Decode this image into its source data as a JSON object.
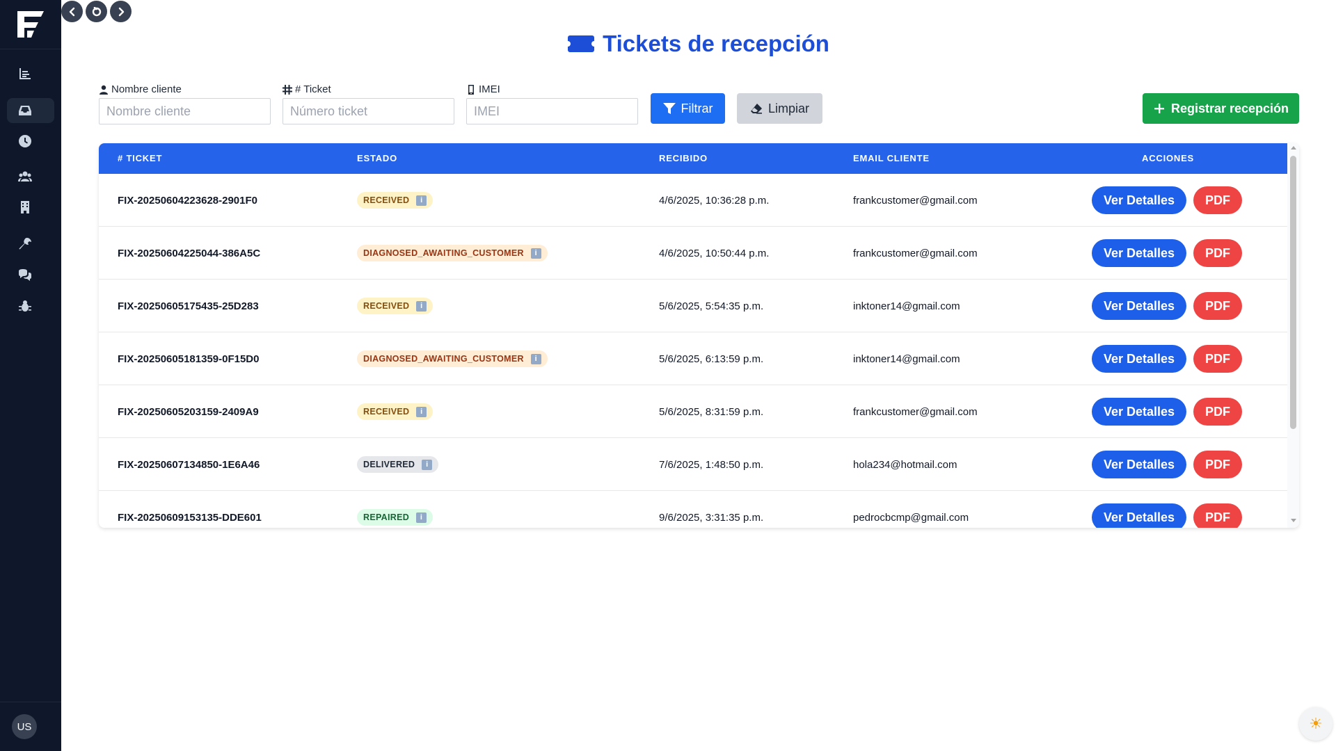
{
  "nav": {
    "back_icon": "chevron-left-icon",
    "reload_icon": "reload-icon",
    "forward_icon": "chevron-right-icon"
  },
  "sidebar": {
    "items": [
      {
        "icon": "chart-icon",
        "active": false
      },
      {
        "icon": "inbox-icon",
        "active": true
      },
      {
        "icon": "clock-icon",
        "active": false
      },
      {
        "icon": "users-icon",
        "active": false
      },
      {
        "icon": "building-icon",
        "active": false
      },
      {
        "icon": "wrench-icon",
        "active": false
      },
      {
        "icon": "chat-icon",
        "active": false
      },
      {
        "icon": "bug-icon",
        "active": false
      }
    ],
    "avatar": "US"
  },
  "page": {
    "title": "Tickets de recepción",
    "title_icon": "ticket-icon",
    "title_color": "#1d4ed8"
  },
  "filters": {
    "name_label": "Nombre cliente",
    "name_placeholder": "Nombre cliente",
    "ticket_label": "# Ticket",
    "ticket_placeholder": "Número ticket",
    "imei_label": "IMEI",
    "imei_placeholder": "IMEI",
    "filter_button": "Filtrar",
    "clear_button": "Limpiar",
    "register_button": "Registrar recepción"
  },
  "table": {
    "headers": [
      "# TICKET",
      "ESTADO",
      "RECIBIDO",
      "EMAIL CLIENTE",
      "ACCIONES"
    ],
    "details_label": "Ver Detalles",
    "pdf_label": "PDF",
    "rows": [
      {
        "ticket": "FIX-20250604223628-2901F0",
        "status": "RECEIVED",
        "status_class": "b-received",
        "received": "4/6/2025, 10:36:28 p.m.",
        "email": "frankcustomer@gmail.com"
      },
      {
        "ticket": "FIX-20250604225044-386A5C",
        "status": "DIAGNOSED_AWAITING_CUSTOMER",
        "status_class": "b-diag",
        "received": "4/6/2025, 10:50:44 p.m.",
        "email": "frankcustomer@gmail.com"
      },
      {
        "ticket": "FIX-20250605175435-25D283",
        "status": "RECEIVED",
        "status_class": "b-received",
        "received": "5/6/2025, 5:54:35 p.m.",
        "email": "inktoner14@gmail.com"
      },
      {
        "ticket": "FIX-20250605181359-0F15D0",
        "status": "DIAGNOSED_AWAITING_CUSTOMER",
        "status_class": "b-diag",
        "received": "5/6/2025, 6:13:59 p.m.",
        "email": "inktoner14@gmail.com"
      },
      {
        "ticket": "FIX-20250605203159-2409A9",
        "status": "RECEIVED",
        "status_class": "b-received",
        "received": "5/6/2025, 8:31:59 p.m.",
        "email": "frankcustomer@gmail.com"
      },
      {
        "ticket": "FIX-20250607134850-1E6A46",
        "status": "DELIVERED",
        "status_class": "b-deliv",
        "received": "7/6/2025, 1:48:50 p.m.",
        "email": "hola234@hotmail.com"
      },
      {
        "ticket": "FIX-20250609153135-DDE601",
        "status": "REPAIRED",
        "status_class": "b-rep",
        "received": "9/6/2025, 3:31:35 p.m.",
        "email": "pedrocbcmp@gmail.com"
      }
    ]
  },
  "theme_toggle_icon": "sun-icon"
}
